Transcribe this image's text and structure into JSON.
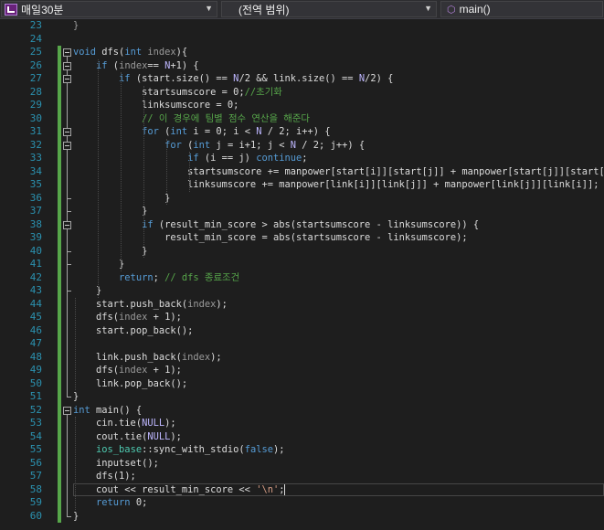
{
  "navbar": {
    "project": "매일30분",
    "scope": "(전역 범위)",
    "member": "main()"
  },
  "editor": {
    "lines": [
      {
        "num": "23",
        "segs": [
          {
            "c": "p",
            "t": "}"
          }
        ]
      },
      {
        "num": "24",
        "segs": []
      },
      {
        "num": "25",
        "segs": [
          {
            "c": "k",
            "t": "void"
          },
          {
            "c": "",
            "t": " dfs("
          },
          {
            "c": "k",
            "t": "int"
          },
          {
            "c": "p",
            "t": " index"
          },
          {
            "c": "",
            "t": "){"
          }
        ]
      },
      {
        "num": "26",
        "segs": [
          {
            "c": "",
            "t": "    "
          },
          {
            "c": "k",
            "t": "if"
          },
          {
            "c": "",
            "t": " ("
          },
          {
            "c": "p",
            "t": "index"
          },
          {
            "c": "",
            "t": "== "
          },
          {
            "c": "m",
            "t": "N"
          },
          {
            "c": "",
            "t": "+1) {"
          }
        ]
      },
      {
        "num": "27",
        "segs": [
          {
            "c": "",
            "t": "        "
          },
          {
            "c": "k",
            "t": "if"
          },
          {
            "c": "",
            "t": " (start.size() == "
          },
          {
            "c": "m",
            "t": "N"
          },
          {
            "c": "",
            "t": "/2 && link.size() == "
          },
          {
            "c": "m",
            "t": "N"
          },
          {
            "c": "",
            "t": "/2) {"
          }
        ]
      },
      {
        "num": "28",
        "segs": [
          {
            "c": "",
            "t": "            startsumscore = 0;"
          },
          {
            "c": "c",
            "t": "//초기화"
          }
        ]
      },
      {
        "num": "29",
        "segs": [
          {
            "c": "",
            "t": "            linksumscore = 0;"
          }
        ]
      },
      {
        "num": "30",
        "segs": [
          {
            "c": "c",
            "t": "            // 이 경우에 팀별 점수 연산을 해준다"
          }
        ]
      },
      {
        "num": "31",
        "segs": [
          {
            "c": "",
            "t": "            "
          },
          {
            "c": "k",
            "t": "for"
          },
          {
            "c": "",
            "t": " ("
          },
          {
            "c": "k",
            "t": "int"
          },
          {
            "c": "",
            "t": " i = 0; i < "
          },
          {
            "c": "m",
            "t": "N"
          },
          {
            "c": "",
            "t": " / 2; i++) {"
          }
        ]
      },
      {
        "num": "32",
        "segs": [
          {
            "c": "",
            "t": "                "
          },
          {
            "c": "k",
            "t": "for"
          },
          {
            "c": "",
            "t": " ("
          },
          {
            "c": "k",
            "t": "int"
          },
          {
            "c": "",
            "t": " j = i+1; j < "
          },
          {
            "c": "m",
            "t": "N"
          },
          {
            "c": "",
            "t": " / 2; j++) {"
          }
        ]
      },
      {
        "num": "33",
        "segs": [
          {
            "c": "",
            "t": "                    "
          },
          {
            "c": "k",
            "t": "if"
          },
          {
            "c": "",
            "t": " (i == j) "
          },
          {
            "c": "k",
            "t": "continue"
          },
          {
            "c": "",
            "t": ";"
          }
        ]
      },
      {
        "num": "34",
        "segs": [
          {
            "c": "",
            "t": "                    startsumscore += manpower[start[i]][start[j]] + manpower[start[j]][start[i]];"
          }
        ]
      },
      {
        "num": "35",
        "segs": [
          {
            "c": "",
            "t": "                    linksumscore += manpower[link[i]][link[j]] + manpower[link[j]][link[i]];"
          }
        ]
      },
      {
        "num": "36",
        "segs": [
          {
            "c": "",
            "t": "                }"
          }
        ]
      },
      {
        "num": "37",
        "segs": [
          {
            "c": "",
            "t": "            }"
          }
        ]
      },
      {
        "num": "38",
        "segs": [
          {
            "c": "",
            "t": "            "
          },
          {
            "c": "k",
            "t": "if"
          },
          {
            "c": "",
            "t": " (result_min_score > abs(startsumscore - linksumscore)) {"
          }
        ]
      },
      {
        "num": "39",
        "segs": [
          {
            "c": "",
            "t": "                result_min_score = abs(startsumscore - linksumscore);"
          }
        ]
      },
      {
        "num": "40",
        "segs": [
          {
            "c": "",
            "t": "            }"
          }
        ]
      },
      {
        "num": "41",
        "segs": [
          {
            "c": "",
            "t": "        }"
          }
        ]
      },
      {
        "num": "42",
        "segs": [
          {
            "c": "",
            "t": "        "
          },
          {
            "c": "k",
            "t": "return"
          },
          {
            "c": "",
            "t": "; "
          },
          {
            "c": "c",
            "t": "// dfs 종료조건"
          }
        ]
      },
      {
        "num": "43",
        "segs": [
          {
            "c": "",
            "t": "    }"
          }
        ]
      },
      {
        "num": "44",
        "segs": [
          {
            "c": "",
            "t": "    start.push_back("
          },
          {
            "c": "p",
            "t": "index"
          },
          {
            "c": "",
            "t": ");"
          }
        ]
      },
      {
        "num": "45",
        "segs": [
          {
            "c": "",
            "t": "    dfs("
          },
          {
            "c": "p",
            "t": "index"
          },
          {
            "c": "",
            "t": " + 1);"
          }
        ]
      },
      {
        "num": "46",
        "segs": [
          {
            "c": "",
            "t": "    start.pop_back();"
          }
        ]
      },
      {
        "num": "47",
        "segs": []
      },
      {
        "num": "48",
        "segs": [
          {
            "c": "",
            "t": "    link.push_back("
          },
          {
            "c": "p",
            "t": "index"
          },
          {
            "c": "",
            "t": ");"
          }
        ]
      },
      {
        "num": "49",
        "segs": [
          {
            "c": "",
            "t": "    dfs("
          },
          {
            "c": "p",
            "t": "index"
          },
          {
            "c": "",
            "t": " + 1);"
          }
        ]
      },
      {
        "num": "50",
        "segs": [
          {
            "c": "",
            "t": "    link.pop_back();"
          }
        ]
      },
      {
        "num": "51",
        "segs": [
          {
            "c": "",
            "t": "}"
          }
        ]
      },
      {
        "num": "52",
        "segs": [
          {
            "c": "k",
            "t": "int"
          },
          {
            "c": "",
            "t": " main() {"
          }
        ]
      },
      {
        "num": "53",
        "segs": [
          {
            "c": "",
            "t": "    cin.tie("
          },
          {
            "c": "m",
            "t": "NULL"
          },
          {
            "c": "",
            "t": ");"
          }
        ]
      },
      {
        "num": "54",
        "segs": [
          {
            "c": "",
            "t": "    cout.tie("
          },
          {
            "c": "m",
            "t": "NULL"
          },
          {
            "c": "",
            "t": ");"
          }
        ]
      },
      {
        "num": "55",
        "segs": [
          {
            "c": "",
            "t": "    "
          },
          {
            "c": "t",
            "t": "ios_base"
          },
          {
            "c": "",
            "t": "::sync_with_stdio("
          },
          {
            "c": "k",
            "t": "false"
          },
          {
            "c": "",
            "t": ");"
          }
        ]
      },
      {
        "num": "56",
        "segs": [
          {
            "c": "",
            "t": "    inputset();"
          }
        ]
      },
      {
        "num": "57",
        "segs": [
          {
            "c": "",
            "t": "    dfs(1);"
          }
        ]
      },
      {
        "num": "58",
        "segs": [
          {
            "c": "",
            "t": "    cout << result_min_score << "
          },
          {
            "c": "s",
            "t": "'\\n'"
          },
          {
            "c": "",
            "t": ";"
          }
        ]
      },
      {
        "num": "59",
        "segs": [
          {
            "c": "",
            "t": "    "
          },
          {
            "c": "k",
            "t": "return"
          },
          {
            "c": "",
            "t": " 0;"
          }
        ]
      },
      {
        "num": "60",
        "segs": [
          {
            "c": "",
            "t": "}"
          }
        ]
      }
    ],
    "current_line": "58",
    "change_bars": [
      [
        "25",
        "51"
      ],
      [
        "52",
        "60"
      ]
    ],
    "fold_markers": [
      "25",
      "26",
      "27",
      "31",
      "32",
      "38",
      "52"
    ]
  },
  "colors": {
    "background": "#1e1e1e",
    "keyword": "#569cd6",
    "comment": "#57a64a",
    "macro": "#beb7ff",
    "string": "#d69d85",
    "line_number": "#2b91af",
    "change_bar": "#57a64a"
  }
}
